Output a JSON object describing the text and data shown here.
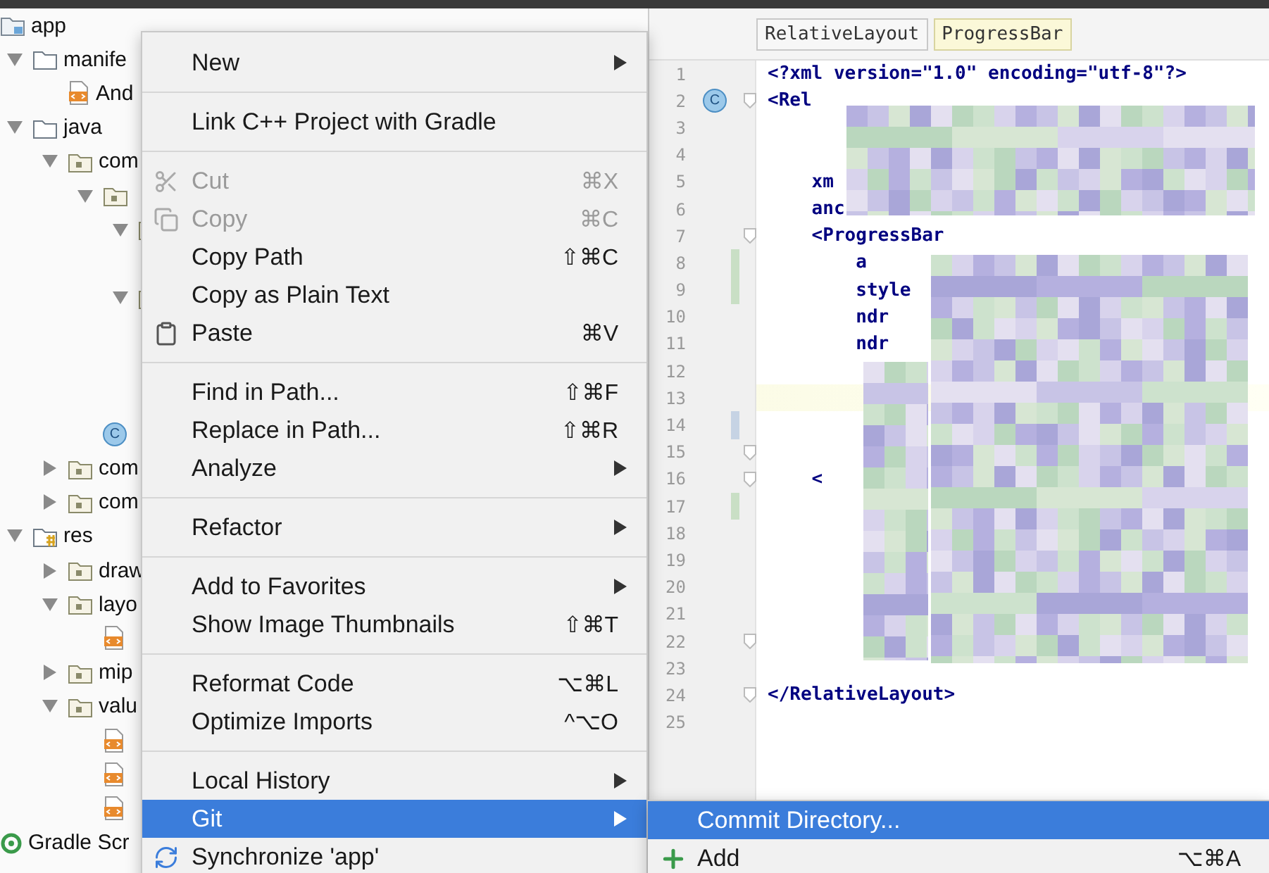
{
  "tree": [
    {
      "label": "app",
      "kind": "module",
      "children": [
        {
          "label": "manife",
          "kind": "folder",
          "expanded": true,
          "children": [
            {
              "label": "And",
              "kind": "xml"
            }
          ]
        },
        {
          "label": "java",
          "kind": "folder",
          "expanded": true,
          "children": [
            {
              "label": "com",
              "kind": "package",
              "expanded": true,
              "children": [
                {
                  "kind": "package",
                  "expanded": true,
                  "children": [
                    {
                      "kind": "package",
                      "expanded": true,
                      "children": [
                        {
                          "kind": "covered"
                        }
                      ]
                    },
                    {
                      "kind": "package",
                      "expanded": true,
                      "children": [
                        {
                          "kind": "covered"
                        },
                        {
                          "kind": "covered"
                        },
                        {
                          "kind": "covered"
                        }
                      ]
                    }
                  ]
                },
                {
                  "kind": "class",
                  "badge": "C"
                }
              ]
            },
            {
              "label": "com",
              "kind": "package",
              "expanded": false
            },
            {
              "label": "com",
              "kind": "package",
              "expanded": false
            }
          ]
        },
        {
          "label": "res",
          "kind": "res",
          "expanded": true,
          "children": [
            {
              "label": "draw",
              "kind": "package",
              "expanded": false
            },
            {
              "label": "layo",
              "kind": "package",
              "expanded": true,
              "children": [
                {
                  "kind": "xml"
                }
              ]
            },
            {
              "label": "mip",
              "kind": "package",
              "expanded": false
            },
            {
              "label": "valu",
              "kind": "package",
              "expanded": true,
              "children": [
                {
                  "kind": "xml"
                },
                {
                  "kind": "xml"
                },
                {
                  "kind": "xml"
                }
              ]
            }
          ]
        }
      ]
    },
    {
      "label": "Gradle Scr",
      "kind": "gradle"
    }
  ],
  "breadcrumbs": [
    {
      "label": "RelativeLayout",
      "selected": false
    },
    {
      "label": "ProgressBar",
      "selected": true
    }
  ],
  "code": [
    {
      "n": "1",
      "text": "<?xml version=\"1.0\" encoding=\"utf-8\"?>",
      "current": false,
      "fold": false
    },
    {
      "n": "2",
      "text": "<Rel",
      "badge": "C",
      "current": false,
      "fold": true
    },
    {
      "n": "3",
      "current": false,
      "fold": false
    },
    {
      "n": "4",
      "current": false,
      "fold": false
    },
    {
      "n": "5",
      "text": "    xm",
      "current": false,
      "fold": false
    },
    {
      "n": "6",
      "text": "    anc",
      "current": false,
      "fold": false
    },
    {
      "n": "7",
      "text": "    <ProgressBar",
      "current": false,
      "fold": true
    },
    {
      "n": "8",
      "text": "        a",
      "color": "#c9dfc5",
      "current": false,
      "fold": false
    },
    {
      "n": "9",
      "text": "        style",
      "color": "#c9dfc5",
      "current": false,
      "fold": false
    },
    {
      "n": "10",
      "text": "        ndr",
      "current": false,
      "fold": false
    },
    {
      "n": "11",
      "text": "        ndr",
      "current": false,
      "fold": false
    },
    {
      "n": "12",
      "current": false,
      "fold": false
    },
    {
      "n": "13",
      "current": true,
      "fold": false
    },
    {
      "n": "14",
      "color": "#c6d3e4",
      "current": false,
      "fold": false
    },
    {
      "n": "15",
      "current": false,
      "fold": true
    },
    {
      "n": "16",
      "text": "    <",
      "current": false,
      "fold": true
    },
    {
      "n": "17",
      "color": "#c9dfc5",
      "current": false,
      "fold": false
    },
    {
      "n": "18",
      "current": false,
      "fold": false
    },
    {
      "n": "19",
      "current": false,
      "fold": false
    },
    {
      "n": "20",
      "current": false,
      "fold": false
    },
    {
      "n": "21",
      "current": false,
      "fold": false
    },
    {
      "n": "22",
      "current": false,
      "fold": true
    },
    {
      "n": "23",
      "current": false,
      "fold": false
    },
    {
      "n": "24",
      "text": "</RelativeLayout>",
      "current": false,
      "fold": true
    },
    {
      "n": "25",
      "current": false,
      "fold": false
    }
  ],
  "menu": {
    "groups": [
      {
        "items": [
          {
            "label": "New",
            "submenu": true,
            "disabled": false,
            "selected": false
          }
        ]
      },
      {
        "items": [
          {
            "label": "Link C++ Project with Gradle",
            "submenu": false,
            "disabled": false,
            "selected": false
          }
        ]
      },
      {
        "items": [
          {
            "label": "Cut",
            "kind": "cut",
            "shortcut": "⌘X",
            "submenu": false,
            "disabled": true,
            "selected": false
          },
          {
            "label": "Copy",
            "kind": "copy",
            "shortcut": "⌘C",
            "submenu": false,
            "disabled": true,
            "selected": false
          },
          {
            "label": "Copy Path",
            "shortcut": "⇧⌘C",
            "submenu": false,
            "disabled": false,
            "selected": false
          },
          {
            "label": "Copy as Plain Text",
            "submenu": false,
            "disabled": false,
            "selected": false
          },
          {
            "label": "Paste",
            "kind": "paste",
            "shortcut": "⌘V",
            "submenu": false,
            "disabled": false,
            "selected": false
          }
        ]
      },
      {
        "items": [
          {
            "label": "Find in Path...",
            "shortcut": "⇧⌘F",
            "submenu": false,
            "disabled": false,
            "selected": false
          },
          {
            "label": "Replace in Path...",
            "shortcut": "⇧⌘R",
            "submenu": false,
            "disabled": false,
            "selected": false
          },
          {
            "label": "Analyze",
            "submenu": true,
            "disabled": false,
            "selected": false
          }
        ]
      },
      {
        "items": [
          {
            "label": "Refactor",
            "submenu": true,
            "disabled": false,
            "selected": false
          }
        ]
      },
      {
        "items": [
          {
            "label": "Add to Favorites",
            "submenu": true,
            "disabled": false,
            "selected": false
          },
          {
            "label": "Show Image Thumbnails",
            "shortcut": "⇧⌘T",
            "submenu": false,
            "disabled": false,
            "selected": false
          }
        ]
      },
      {
        "items": [
          {
            "label": "Reformat Code",
            "shortcut": "⌥⌘L",
            "submenu": false,
            "disabled": false,
            "selected": false
          },
          {
            "label": "Optimize Imports",
            "shortcut": "^⌥O",
            "submenu": false,
            "disabled": false,
            "selected": false
          }
        ]
      },
      {
        "items": [
          {
            "label": "Local History",
            "submenu": true,
            "disabled": false,
            "selected": false
          },
          {
            "label": "Git",
            "submenu": true,
            "disabled": false,
            "selected": true
          },
          {
            "label": "Synchronize 'app'",
            "kind": "sync",
            "submenu": false,
            "disabled": false,
            "selected": false
          }
        ]
      }
    ]
  },
  "submenu": [
    {
      "label": "Commit Directory...",
      "selected": true
    },
    {
      "label": "Add",
      "kind": "add",
      "shortcut": "⌥⌘A",
      "selected": false
    }
  ]
}
